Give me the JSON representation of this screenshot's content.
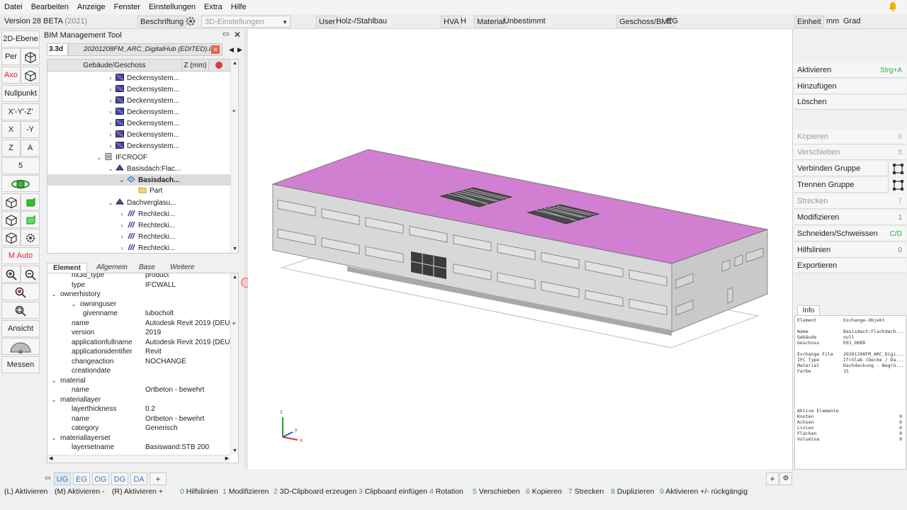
{
  "menu": [
    "Datei",
    "Bearbeiten",
    "Anzeige",
    "Fenster",
    "Einstellungen",
    "Extra",
    "Hilfe"
  ],
  "toolbar": {
    "version": "Version 28 BETA",
    "version_year": "(2021)",
    "beschriftung": "Beschriftung",
    "view_settings": "3D-Einstellungen",
    "user_label": "User",
    "user_value": "Holz-/Stahlbau",
    "hva_label": "HVA",
    "hva_value": "H",
    "material_label": "Material",
    "material_value": "Unbestimmt",
    "geschoss_label": "Geschoss/BMT",
    "geschoss_value": "EG",
    "einheit_label": "Einheit",
    "unit_length": "mm",
    "unit_angle": "Grad"
  },
  "left_toolbar": {
    "ebene": "2D-Ebene",
    "per": "Per",
    "axo": "Axo",
    "nullpunkt": "Nullpunkt",
    "xyz": "X'-Y'-Z'",
    "x": "X",
    "neg_y": "-Y",
    "z": "Z",
    "a": "A",
    "five": "5",
    "m_auto": "M Auto",
    "ansicht": "Ansicht",
    "messen": "Messen"
  },
  "bim": {
    "title": "BIM Management Tool",
    "file_tab_short": "3.3d",
    "file_tab_name": "20201208FM_ARC_DigitalHub (EDITED).ifc",
    "tree_header_name": "Gebäude/Geschoss",
    "tree_header_z": "Z (mm)",
    "tree_rows": [
      {
        "indent": 1,
        "label": "Deckensystem...",
        "icon": "slab"
      },
      {
        "indent": 1,
        "label": "Deckensystem...",
        "icon": "slab"
      },
      {
        "indent": 1,
        "label": "Deckensystem...",
        "icon": "slab"
      },
      {
        "indent": 1,
        "label": "Deckensystem...",
        "icon": "slab"
      },
      {
        "indent": 1,
        "label": "Deckensystem...",
        "icon": "slab"
      },
      {
        "indent": 1,
        "label": "Deckensystem...",
        "icon": "slab"
      },
      {
        "indent": 1,
        "label": "Deckensystem...",
        "icon": "slab"
      },
      {
        "indent": 0,
        "label": "IFCROOF",
        "icon": "roof",
        "open": true
      },
      {
        "indent": 1,
        "label": "Basisdach:Flac...",
        "icon": "roofpart",
        "open": true
      },
      {
        "indent": 2,
        "label": "Basisdach...",
        "icon": "selected",
        "open": true,
        "selected": true
      },
      {
        "indent": 3,
        "label": "Part",
        "icon": "part"
      },
      {
        "indent": 1,
        "label": "Dachverglasu...",
        "icon": "roofpart",
        "open": true
      },
      {
        "indent": 2,
        "label": "Rechtecki...",
        "icon": "rect"
      },
      {
        "indent": 2,
        "label": "Rechtecki...",
        "icon": "rect"
      },
      {
        "indent": 2,
        "label": "Rechtecki...",
        "icon": "rect"
      },
      {
        "indent": 2,
        "label": "Rechtecki...",
        "icon": "rect"
      }
    ],
    "prop_tabs": [
      "Element",
      "Allgemein",
      "Base",
      "Weitere"
    ],
    "props": [
      {
        "indent": 1,
        "key": "hx3d_type",
        "value": "product"
      },
      {
        "indent": 1,
        "key": "type",
        "value": "IFCWALL"
      },
      {
        "indent": 0,
        "key": "ownerhistory",
        "value": "",
        "group": true
      },
      {
        "indent": 1,
        "key": "owninguser",
        "value": "",
        "group": true
      },
      {
        "indent": 2,
        "key": "givenname",
        "value": "lubocholt"
      },
      {
        "indent": 1,
        "key": "name",
        "value": "Autodesk Revit 2019 (DEU)"
      },
      {
        "indent": 1,
        "key": "version",
        "value": "2019"
      },
      {
        "indent": 1,
        "key": "applicationfullname",
        "value": "Autodesk Revit 2019 (DEU)"
      },
      {
        "indent": 1,
        "key": "applicationidentifier",
        "value": "Revit"
      },
      {
        "indent": 1,
        "key": "changeaction",
        "value": "NOCHANGE"
      },
      {
        "indent": 1,
        "key": "creationdate",
        "value": ""
      },
      {
        "indent": 0,
        "key": "material",
        "value": "",
        "group": true
      },
      {
        "indent": 1,
        "key": "name",
        "value": "Ortbeton - bewehrt"
      },
      {
        "indent": 0,
        "key": "materiallayer",
        "value": "",
        "group": true
      },
      {
        "indent": 1,
        "key": "layerthickness",
        "value": "0.2"
      },
      {
        "indent": 1,
        "key": "name",
        "value": "Ortbeton - bewehrt"
      },
      {
        "indent": 1,
        "key": "category",
        "value": "Generisch"
      },
      {
        "indent": 0,
        "key": "materiallayerset",
        "value": "",
        "group": true
      },
      {
        "indent": 1,
        "key": "layersetname",
        "value": "Basiswand:STB 200"
      }
    ]
  },
  "viewport": {
    "axis_z": "z",
    "axis_y": "y",
    "axis_x": "x",
    "colors": {
      "roof": "#d17fd1",
      "wall": "#d9d9d9",
      "wall_dark": "#c4c4c4"
    }
  },
  "right_panel": {
    "buttons": [
      {
        "label": "Aktivieren",
        "shortcut": "Strg+A",
        "enabled": true
      },
      {
        "label": "Hinzufügen",
        "shortcut": "",
        "enabled": true
      },
      {
        "label": "Löschen",
        "shortcut": "",
        "enabled": true
      },
      {
        "label": "Kopieren",
        "shortcut": "6",
        "enabled": false
      },
      {
        "label": "Verschieben",
        "shortcut": "5",
        "enabled": false
      },
      {
        "label": "Verbinden Gruppe",
        "shortcut": "",
        "enabled": true,
        "icon": true
      },
      {
        "label": "Trennen Gruppe",
        "shortcut": "",
        "enabled": true,
        "icon": true
      },
      {
        "label": "Strecken",
        "shortcut": "7",
        "enabled": false
      },
      {
        "label": "Modifizieren",
        "shortcut": "1",
        "enabled": true
      },
      {
        "label": "Schneiden/Schweissen",
        "shortcut": "C/D",
        "enabled": true
      },
      {
        "label": "Hilfslinien",
        "shortcut": "0",
        "enabled": true
      },
      {
        "label": "Exportieren",
        "shortcut": "",
        "enabled": true
      }
    ],
    "info_tab": "Info",
    "info_rows": [
      {
        "k": "Element",
        "v": "Exchange-Objekt"
      },
      {
        "k": "",
        "v": ""
      },
      {
        "k": "Name",
        "v": "Basisdach:Flachdach..."
      },
      {
        "k": "Gebäude",
        "v": "null"
      },
      {
        "k": "Geschoss",
        "v": "E01_OKRD"
      },
      {
        "k": "",
        "v": ""
      },
      {
        "k": "Exchange File",
        "v": "20201208FM_ARC_Digi..."
      },
      {
        "k": "IFC Type",
        "v": "IfcSlab (Decke / Da..."
      },
      {
        "k": "Material",
        "v": "Dachdeckung - Begrü..."
      },
      {
        "k": "Farbe",
        "v": "15"
      }
    ],
    "active_title": "Aktive Elemente",
    "active_rows": [
      {
        "k": "Knoten",
        "v": "0"
      },
      {
        "k": "Achsen",
        "v": "0"
      },
      {
        "k": "Linien",
        "v": "0"
      },
      {
        "k": "Flächen",
        "v": "0"
      },
      {
        "k": "Volumina",
        "v": "0"
      }
    ]
  },
  "bottom_tabs": [
    "UG",
    "EG",
    "OG",
    "DG",
    "DA",
    "+"
  ],
  "status": [
    {
      "n": "",
      "t": "(L) Aktivieren"
    },
    {
      "n": "",
      "t": "(M) Aktivieren -"
    },
    {
      "n": "",
      "t": "(R) Aktivieren +"
    },
    {
      "n": "0",
      "t": "Hilfslinien"
    },
    {
      "n": "1",
      "t": "Modifizieren"
    },
    {
      "n": "2",
      "t": "3D-Clipboard erzeugen"
    },
    {
      "n": "3",
      "t": "Clipboard einfügen"
    },
    {
      "n": "4",
      "t": "Rotation"
    },
    {
      "n": "5",
      "t": "Verschieben"
    },
    {
      "n": "6",
      "t": "Kopieren"
    },
    {
      "n": "7",
      "t": "Strecken"
    },
    {
      "n": "8",
      "t": "Duplizieren"
    },
    {
      "n": "9",
      "t": "Aktivieren +/- rückgängig"
    }
  ]
}
